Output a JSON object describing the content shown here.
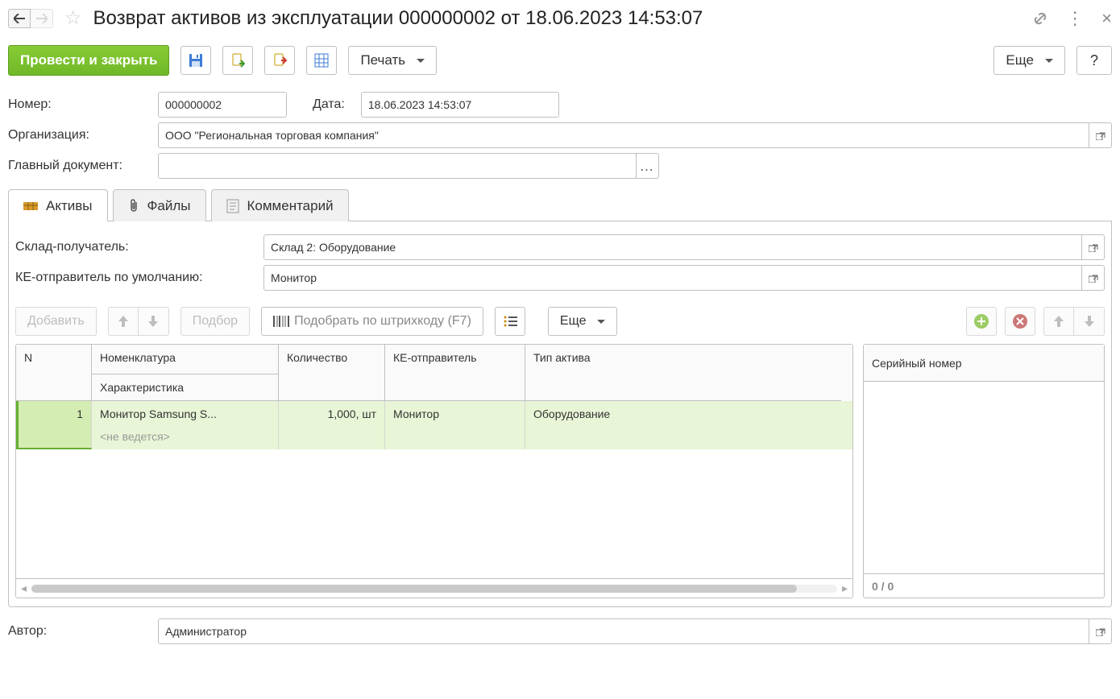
{
  "window": {
    "title": "Возврат активов из эксплуатации 000000002 от 18.06.2023 14:53:07"
  },
  "toolbar": {
    "submit_label": "Провести и закрыть",
    "print_label": "Печать",
    "more_label": "Еще",
    "help_label": "?"
  },
  "form": {
    "number_label": "Номер:",
    "number_value": "000000002",
    "date_label": "Дата:",
    "date_value": "18.06.2023 14:53:07",
    "org_label": "Организация:",
    "org_value": "ООО \"Региональная торговая компания\"",
    "main_doc_label": "Главный документ:",
    "main_doc_value": ""
  },
  "tabs": {
    "assets": "Активы",
    "files": "Файлы",
    "comment": "Комментарий"
  },
  "assets_tab": {
    "warehouse_label": "Склад-получатель:",
    "warehouse_value": "Склад 2: Оборудование",
    "ke_sender_label": "КЕ-отправитель по умолчанию:",
    "ke_sender_value": "Монитор",
    "toolbar": {
      "add_label": "Добавить",
      "pick_label": "Подбор",
      "barcode_label": "Подобрать по штрихкоду (F7)",
      "more_label": "Еще"
    },
    "table": {
      "columns": {
        "n": "N",
        "nomenclature": "Номенклатура",
        "characteristic": "Характеристика",
        "quantity": "Количество",
        "ke_sender": "КЕ-отправитель",
        "asset_type": "Тип актива"
      },
      "rows": [
        {
          "n": "1",
          "nomenclature": "Монитор Samsung S...",
          "characteristic": "<не ведется>",
          "quantity": "1,000, шт",
          "ke_sender": "Монитор",
          "asset_type": "Оборудование"
        }
      ]
    },
    "serials": {
      "header": "Серийный номер",
      "footer": "0 / 0"
    }
  },
  "footer": {
    "author_label": "Автор:",
    "author_value": "Администратор"
  }
}
